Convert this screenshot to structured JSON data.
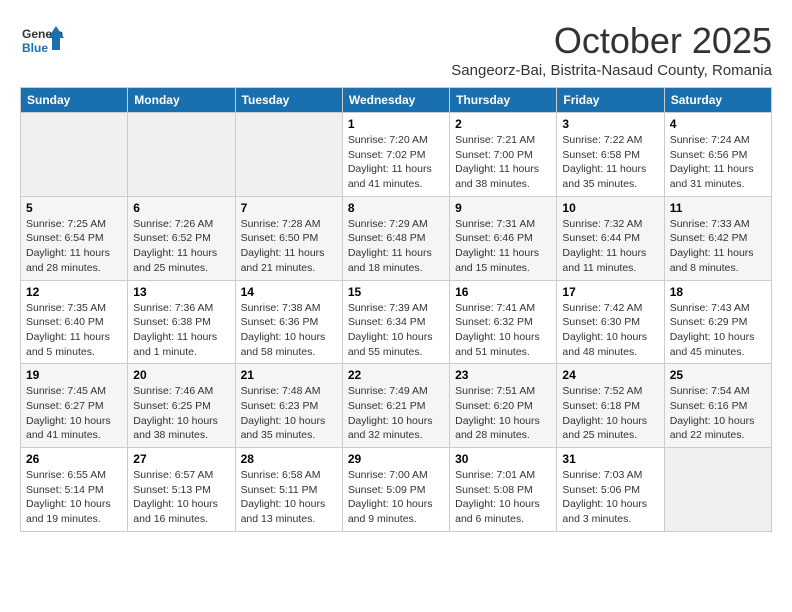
{
  "logo": {
    "general": "General",
    "blue": "Blue"
  },
  "header": {
    "title": "October 2025",
    "subtitle": "Sangeorz-Bai, Bistrita-Nasaud County, Romania"
  },
  "weekdays": [
    "Sunday",
    "Monday",
    "Tuesday",
    "Wednesday",
    "Thursday",
    "Friday",
    "Saturday"
  ],
  "weeks": [
    [
      {
        "day": "",
        "info": ""
      },
      {
        "day": "",
        "info": ""
      },
      {
        "day": "",
        "info": ""
      },
      {
        "day": "1",
        "info": "Sunrise: 7:20 AM\nSunset: 7:02 PM\nDaylight: 11 hours\nand 41 minutes."
      },
      {
        "day": "2",
        "info": "Sunrise: 7:21 AM\nSunset: 7:00 PM\nDaylight: 11 hours\nand 38 minutes."
      },
      {
        "day": "3",
        "info": "Sunrise: 7:22 AM\nSunset: 6:58 PM\nDaylight: 11 hours\nand 35 minutes."
      },
      {
        "day": "4",
        "info": "Sunrise: 7:24 AM\nSunset: 6:56 PM\nDaylight: 11 hours\nand 31 minutes."
      }
    ],
    [
      {
        "day": "5",
        "info": "Sunrise: 7:25 AM\nSunset: 6:54 PM\nDaylight: 11 hours\nand 28 minutes."
      },
      {
        "day": "6",
        "info": "Sunrise: 7:26 AM\nSunset: 6:52 PM\nDaylight: 11 hours\nand 25 minutes."
      },
      {
        "day": "7",
        "info": "Sunrise: 7:28 AM\nSunset: 6:50 PM\nDaylight: 11 hours\nand 21 minutes."
      },
      {
        "day": "8",
        "info": "Sunrise: 7:29 AM\nSunset: 6:48 PM\nDaylight: 11 hours\nand 18 minutes."
      },
      {
        "day": "9",
        "info": "Sunrise: 7:31 AM\nSunset: 6:46 PM\nDaylight: 11 hours\nand 15 minutes."
      },
      {
        "day": "10",
        "info": "Sunrise: 7:32 AM\nSunset: 6:44 PM\nDaylight: 11 hours\nand 11 minutes."
      },
      {
        "day": "11",
        "info": "Sunrise: 7:33 AM\nSunset: 6:42 PM\nDaylight: 11 hours\nand 8 minutes."
      }
    ],
    [
      {
        "day": "12",
        "info": "Sunrise: 7:35 AM\nSunset: 6:40 PM\nDaylight: 11 hours\nand 5 minutes."
      },
      {
        "day": "13",
        "info": "Sunrise: 7:36 AM\nSunset: 6:38 PM\nDaylight: 11 hours\nand 1 minute."
      },
      {
        "day": "14",
        "info": "Sunrise: 7:38 AM\nSunset: 6:36 PM\nDaylight: 10 hours\nand 58 minutes."
      },
      {
        "day": "15",
        "info": "Sunrise: 7:39 AM\nSunset: 6:34 PM\nDaylight: 10 hours\nand 55 minutes."
      },
      {
        "day": "16",
        "info": "Sunrise: 7:41 AM\nSunset: 6:32 PM\nDaylight: 10 hours\nand 51 minutes."
      },
      {
        "day": "17",
        "info": "Sunrise: 7:42 AM\nSunset: 6:30 PM\nDaylight: 10 hours\nand 48 minutes."
      },
      {
        "day": "18",
        "info": "Sunrise: 7:43 AM\nSunset: 6:29 PM\nDaylight: 10 hours\nand 45 minutes."
      }
    ],
    [
      {
        "day": "19",
        "info": "Sunrise: 7:45 AM\nSunset: 6:27 PM\nDaylight: 10 hours\nand 41 minutes."
      },
      {
        "day": "20",
        "info": "Sunrise: 7:46 AM\nSunset: 6:25 PM\nDaylight: 10 hours\nand 38 minutes."
      },
      {
        "day": "21",
        "info": "Sunrise: 7:48 AM\nSunset: 6:23 PM\nDaylight: 10 hours\nand 35 minutes."
      },
      {
        "day": "22",
        "info": "Sunrise: 7:49 AM\nSunset: 6:21 PM\nDaylight: 10 hours\nand 32 minutes."
      },
      {
        "day": "23",
        "info": "Sunrise: 7:51 AM\nSunset: 6:20 PM\nDaylight: 10 hours\nand 28 minutes."
      },
      {
        "day": "24",
        "info": "Sunrise: 7:52 AM\nSunset: 6:18 PM\nDaylight: 10 hours\nand 25 minutes."
      },
      {
        "day": "25",
        "info": "Sunrise: 7:54 AM\nSunset: 6:16 PM\nDaylight: 10 hours\nand 22 minutes."
      }
    ],
    [
      {
        "day": "26",
        "info": "Sunrise: 6:55 AM\nSunset: 5:14 PM\nDaylight: 10 hours\nand 19 minutes."
      },
      {
        "day": "27",
        "info": "Sunrise: 6:57 AM\nSunset: 5:13 PM\nDaylight: 10 hours\nand 16 minutes."
      },
      {
        "day": "28",
        "info": "Sunrise: 6:58 AM\nSunset: 5:11 PM\nDaylight: 10 hours\nand 13 minutes."
      },
      {
        "day": "29",
        "info": "Sunrise: 7:00 AM\nSunset: 5:09 PM\nDaylight: 10 hours\nand 9 minutes."
      },
      {
        "day": "30",
        "info": "Sunrise: 7:01 AM\nSunset: 5:08 PM\nDaylight: 10 hours\nand 6 minutes."
      },
      {
        "day": "31",
        "info": "Sunrise: 7:03 AM\nSunset: 5:06 PM\nDaylight: 10 hours\nand 3 minutes."
      },
      {
        "day": "",
        "info": ""
      }
    ]
  ]
}
